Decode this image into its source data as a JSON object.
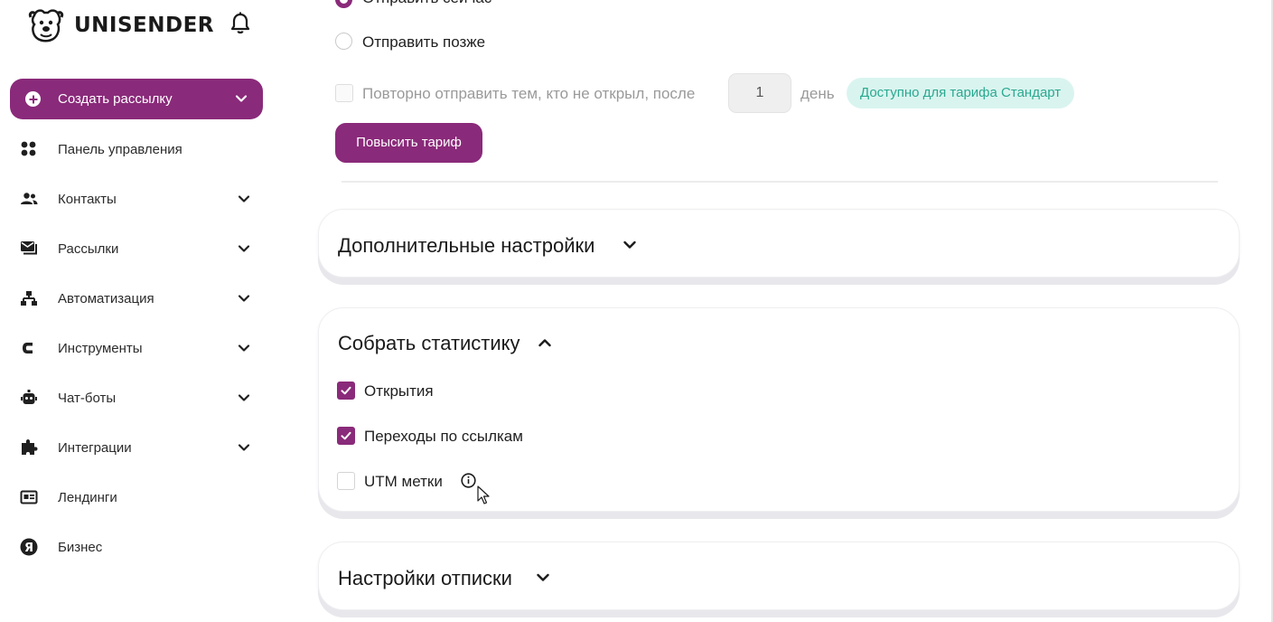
{
  "brand": {
    "name": "UNISENDER"
  },
  "sidebar": {
    "create_label": "Создать рассылку",
    "items": [
      {
        "label": "Панель управления",
        "icon": "dashboard-icon",
        "has_chevron": false
      },
      {
        "label": "Контакты",
        "icon": "contacts-icon",
        "has_chevron": true
      },
      {
        "label": "Рассылки",
        "icon": "mailings-icon",
        "has_chevron": true
      },
      {
        "label": "Автоматизация",
        "icon": "automation-icon",
        "has_chevron": true
      },
      {
        "label": "Инструменты",
        "icon": "tools-icon",
        "has_chevron": true
      },
      {
        "label": "Чат-боты",
        "icon": "chatbot-icon",
        "has_chevron": true
      },
      {
        "label": "Интеграции",
        "icon": "puzzle-icon",
        "has_chevron": true
      },
      {
        "label": "Лендинги",
        "icon": "landing-icon",
        "has_chevron": false
      },
      {
        "label": "Бизнес",
        "icon": "yandex-icon",
        "has_chevron": false
      }
    ]
  },
  "send": {
    "option_now": "Отправить сейчас",
    "option_later": "Отправить позже",
    "resend_label": "Повторно отправить тем, кто не открыл, после",
    "resend_days_value": "1",
    "resend_days_unit": "день",
    "tariff_badge": "Доступно для тарифа Стандарт",
    "upgrade_button": "Повысить тариф"
  },
  "sections": {
    "additional": {
      "title": "Дополнительные настройки"
    },
    "stats": {
      "title": "Собрать статистику",
      "options": [
        {
          "label": "Открытия",
          "checked": true
        },
        {
          "label": "Переходы по ссылкам",
          "checked": true
        },
        {
          "label": "UTM метки",
          "checked": false
        }
      ]
    },
    "unsubscribe": {
      "title": "Настройки отписки"
    }
  },
  "colors": {
    "brand": "#8a2a7a",
    "badge_bg": "#d9f4ef",
    "badge_text": "#2aa890"
  }
}
